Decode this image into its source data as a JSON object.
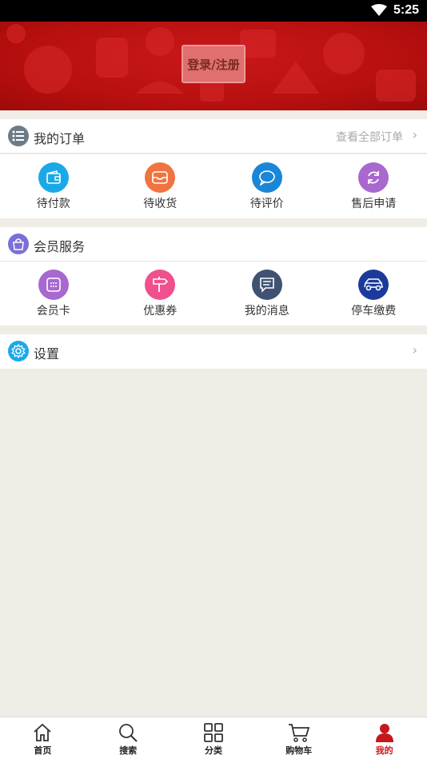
{
  "status_bar": {
    "time": "5:25",
    "wifi_icon": "wifi-icon"
  },
  "banner": {
    "login_label": "登录/注册",
    "background_color": "#b8100f"
  },
  "orders": {
    "title": "我的订单",
    "view_all": "查看全部订单",
    "chevron": "›",
    "icon": "list-icon",
    "items": [
      {
        "label": "待付款",
        "icon": "wallet-icon",
        "color": "#1aa9e8"
      },
      {
        "label": "待收货",
        "icon": "inbox-icon",
        "color": "#f0743f"
      },
      {
        "label": "待评价",
        "icon": "chat-bubble-icon",
        "color": "#1a86d8"
      },
      {
        "label": "售后申请",
        "icon": "refresh-icon",
        "color": "#a868cf"
      }
    ]
  },
  "member": {
    "title": "会员服务",
    "icon": "bag-icon",
    "items": [
      {
        "label": "会员卡",
        "icon": "card-icon",
        "color": "#a868cf"
      },
      {
        "label": "优惠券",
        "icon": "signpost-icon",
        "color": "#f0508d"
      },
      {
        "label": "我的消息",
        "icon": "message-icon",
        "color": "#3f5272"
      },
      {
        "label": "停车缴费",
        "icon": "car-icon",
        "color": "#1b3a9b"
      }
    ]
  },
  "settings": {
    "title": "设置",
    "icon": "gear-icon",
    "chevron": "›"
  },
  "bottom_nav": [
    {
      "label": "首页",
      "icon": "home-icon",
      "active": false
    },
    {
      "label": "搜索",
      "icon": "search-icon",
      "active": false
    },
    {
      "label": "分类",
      "icon": "grid-icon",
      "active": false
    },
    {
      "label": "购物车",
      "icon": "cart-icon",
      "active": false
    },
    {
      "label": "我的",
      "icon": "user-icon",
      "active": true
    }
  ],
  "colors": {
    "accent": "#c8161d",
    "page_bg": "#f0ede6"
  }
}
